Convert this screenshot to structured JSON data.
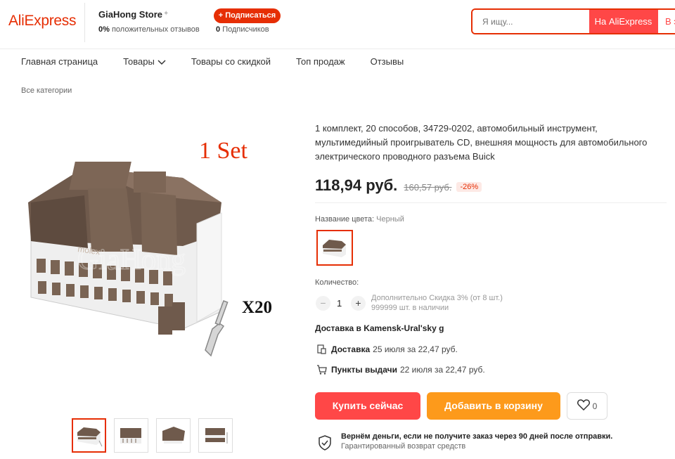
{
  "header": {
    "logo": "AliExpress",
    "store_name": "GiaHong Store",
    "positive_reviews_value": "0%",
    "positive_reviews_label": "положительных отзывов",
    "subscribe_label": "+ Подписаться",
    "followers_value": "0",
    "followers_label": "Подписчиков",
    "search_placeholder": "Я ищу...",
    "search_aliexpress": "На AliExpress",
    "search_store": "В э"
  },
  "nav": {
    "items": [
      "Главная страница",
      "Товары",
      "Товары со скидкой",
      "Топ продаж",
      "Отзывы"
    ],
    "breadcrumb": "Все категории"
  },
  "image": {
    "label_set": "1 Set",
    "label_qty": "X20",
    "watermark": "GiaHong",
    "brand_mark": "molex",
    "thumbnails": 4,
    "active_thumbnail": 1
  },
  "product": {
    "title": "1 комплект, 20 способов, 34729-0202, автомобильный инструмент, мультимедийный проигрыватель CD, внешняя мощность для автомобильного электрического проводного разъема Buick",
    "price": "118,94 руб.",
    "old_price": "160,57 руб.",
    "discount": "-26%",
    "color_label": "Название цвета:",
    "color_value": "Черный",
    "quantity_label": "Количество:",
    "quantity": "1",
    "extra_discount": "Дополнительно Скидка 3% (от 8 шт.)",
    "stock": "999999 шт. в наличии"
  },
  "delivery": {
    "title": "Доставка в Kamensk-Ural'sky g",
    "courier_label": "Доставка",
    "courier_text": "25 июля за 22,47 руб.",
    "pickup_label": "Пункты выдачи",
    "pickup_text": "22 июля за 22,47 руб."
  },
  "actions": {
    "buy_now": "Купить сейчас",
    "add_to_cart": "Добавить в корзину",
    "wishlist_count": "0"
  },
  "guarantee": {
    "main": "Вернём деньги, если не получите заказ через 90 дней после отправки.",
    "sub": "Гарантированный возврат средств"
  },
  "colors": {
    "accent": "#e62e04",
    "buy": "#ff4747",
    "cart": "#fd9a1b",
    "connector_brown": "#6f5a4c",
    "connector_white": "#efefef"
  }
}
